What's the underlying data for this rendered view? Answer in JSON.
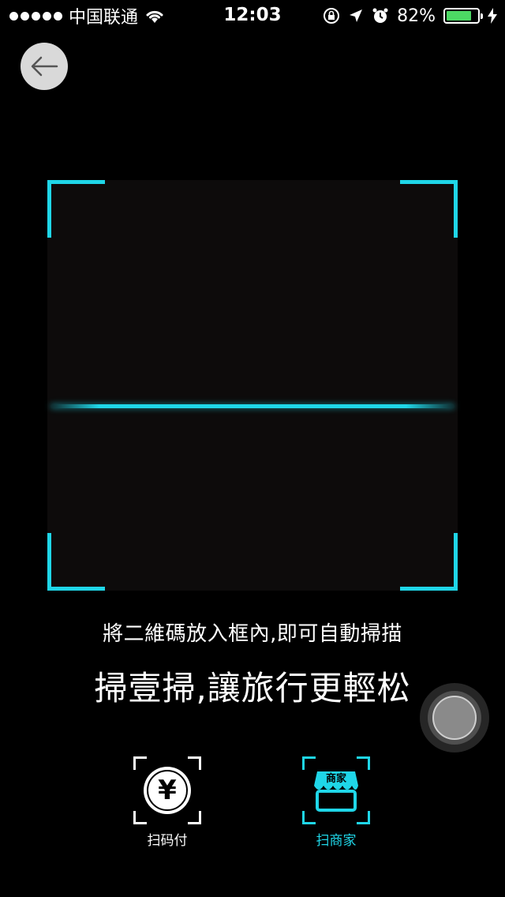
{
  "status_bar": {
    "carrier": "中国联通",
    "time": "12:03",
    "battery_percent": "82%",
    "battery_level": 0.82,
    "icons": [
      "signal-dots",
      "wifi-icon",
      "orientation-lock-icon",
      "location-icon",
      "alarm-icon",
      "battery-icon",
      "charging-icon"
    ]
  },
  "back_button": {
    "icon": "arrow-left-icon"
  },
  "scanner": {
    "hint": "將二維碼放入框內,即可自動掃描",
    "slogan": "掃壹掃,讓旅行更輕松",
    "accent_color": "#1fd6e8"
  },
  "actions": [
    {
      "label": "扫码付",
      "icon": "yen-icon",
      "active": false
    },
    {
      "label": "扫商家",
      "icon": "shop-icon",
      "icon_text": "商家",
      "active": true
    }
  ],
  "assistive_touch": {
    "icon": "assistive-touch-icon"
  }
}
